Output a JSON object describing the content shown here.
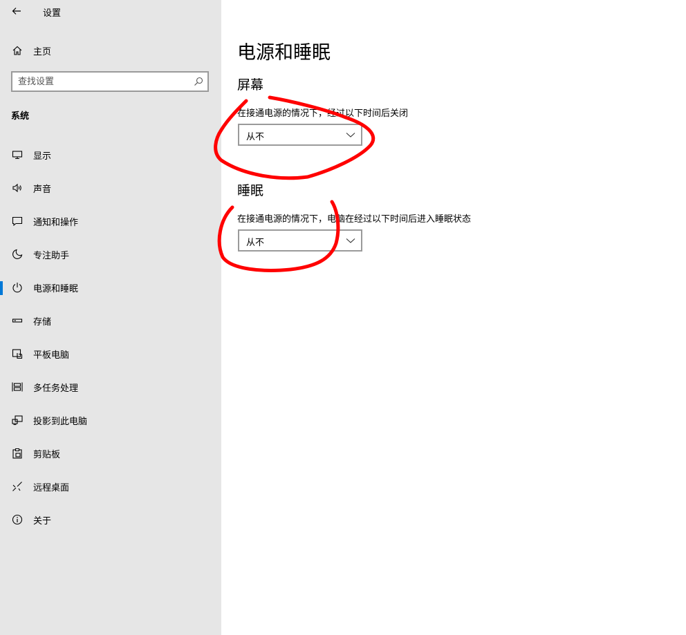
{
  "window": {
    "title": "设置"
  },
  "sidebar": {
    "home_label": "主页",
    "search_placeholder": "查找设置",
    "section_label": "系统",
    "items": [
      {
        "label": "显示",
        "icon": "monitor-icon"
      },
      {
        "label": "声音",
        "icon": "speaker-icon"
      },
      {
        "label": "通知和操作",
        "icon": "message-icon"
      },
      {
        "label": "专注助手",
        "icon": "moon-icon"
      },
      {
        "label": "电源和睡眠",
        "icon": "power-icon",
        "active": true
      },
      {
        "label": "存储",
        "icon": "storage-icon"
      },
      {
        "label": "平板电脑",
        "icon": "tablet-icon"
      },
      {
        "label": "多任务处理",
        "icon": "multitask-icon"
      },
      {
        "label": "投影到此电脑",
        "icon": "project-icon"
      },
      {
        "label": "剪贴板",
        "icon": "clipboard-icon"
      },
      {
        "label": "远程桌面",
        "icon": "remote-icon"
      },
      {
        "label": "关于",
        "icon": "info-icon"
      }
    ]
  },
  "main": {
    "title": "电源和睡眠",
    "screen": {
      "heading": "屏幕",
      "description": "在接通电源的情况下，经过以下时间后关闭",
      "value": "从不"
    },
    "sleep": {
      "heading": "睡眠",
      "description": "在接通电源的情况下，电脑在经过以下时间后进入睡眠状态",
      "value": "从不"
    }
  },
  "colors": {
    "sidebar_bg": "#e6e6e6",
    "accent": "#0078d7",
    "annotation": "#ff0000"
  }
}
